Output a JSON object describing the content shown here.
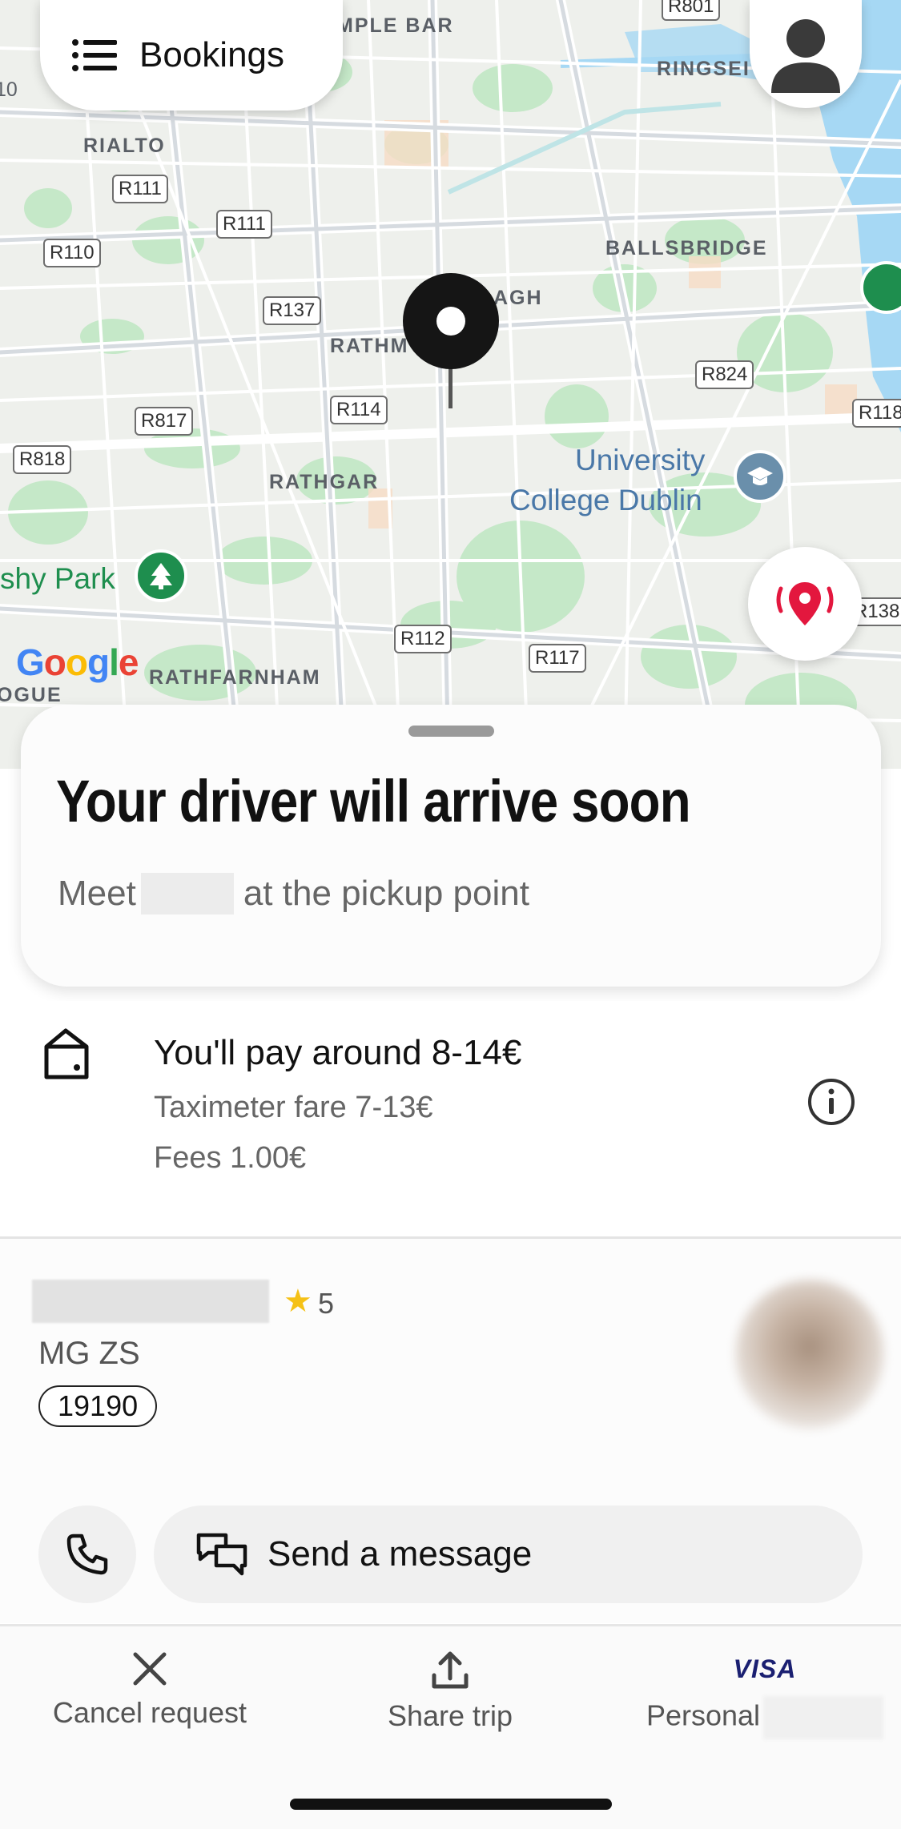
{
  "map": {
    "places": [
      "MPLE BAR",
      "RINGSEI",
      "RIALTO",
      "BALLSBRIDGE",
      "AGH",
      "RATHM",
      "RATHGAR",
      "RATHFARNHAM",
      "OGUE",
      "10"
    ],
    "university": [
      "University",
      "College Dublin"
    ],
    "park": "shy Park",
    "roads": [
      "R801",
      "R111",
      "R111",
      "R110",
      "R137",
      "R824",
      "R114",
      "R817",
      "R118",
      "R818",
      "R112",
      "R117",
      "R138"
    ],
    "google": [
      "G",
      "o",
      "o",
      "g",
      "l",
      "e"
    ]
  },
  "header": {
    "bookings_label": "Bookings"
  },
  "status": {
    "headline": "Your driver will arrive soon",
    "meet_prefix": "Meet",
    "meet_suffix": "at the pickup point"
  },
  "fare": {
    "title": "You'll pay around 8-14€",
    "taximeter": "Taximeter fare 7-13€",
    "fees": "Fees 1.00€"
  },
  "driver": {
    "rating": "5",
    "car_model": "MG ZS",
    "plate": "19190"
  },
  "actions": {
    "message_label": "Send a message"
  },
  "bottom_bar": {
    "cancel_label": "Cancel request",
    "share_label": "Share trip",
    "payment_brand": "VISA",
    "payment_label": "Personal"
  },
  "colors": {
    "accent_red": "#e3173e",
    "map_bg": "#eef0ec",
    "park_green": "#c5e8c8"
  }
}
